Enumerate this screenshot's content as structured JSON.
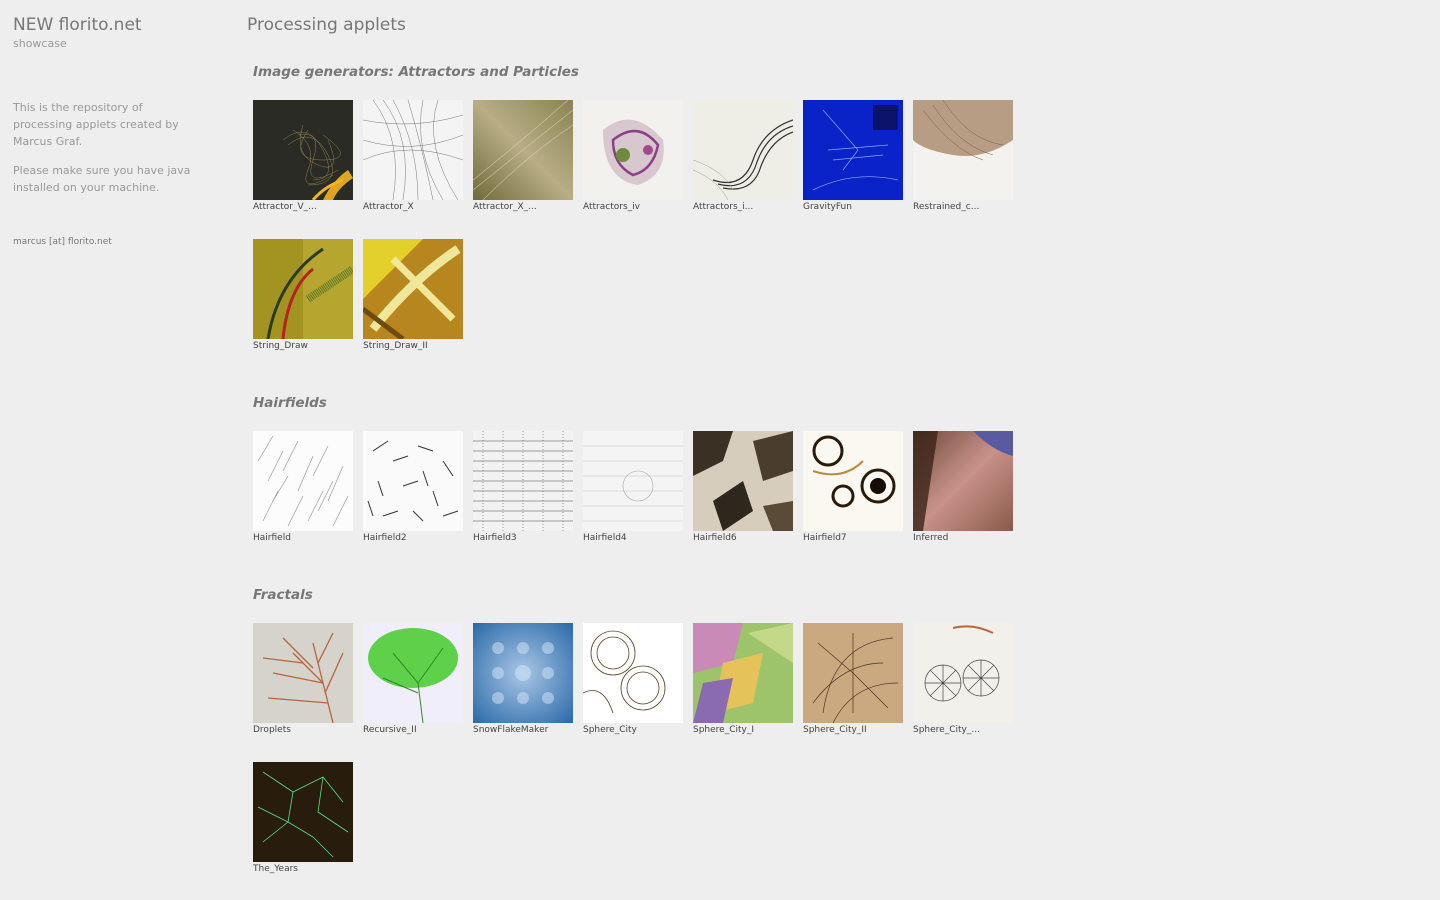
{
  "sidebar": {
    "title": "NEW florito.net",
    "subtitle": "showcase",
    "description": "This is the repository of processing applets created by Marcus Graf.",
    "java_note": "Please make sure you have java installed on your machine.",
    "contact": "marcus [at] florito.net"
  },
  "main": {
    "title": "Processing applets",
    "sections": [
      {
        "title": "Image generators: Attractors and Particles",
        "items": [
          {
            "label": "Attractor_V_..."
          },
          {
            "label": "Attractor_X"
          },
          {
            "label": "Attractor_X_..."
          },
          {
            "label": "Attractors_iv"
          },
          {
            "label": "Attractors_i..."
          },
          {
            "label": "GravityFun"
          },
          {
            "label": "Restrained_c..."
          },
          {
            "label": "String_Draw"
          },
          {
            "label": "String_Draw_II"
          }
        ]
      },
      {
        "title": "Hairfields",
        "items": [
          {
            "label": "Hairfield"
          },
          {
            "label": "Hairfield2"
          },
          {
            "label": "Hairfield3"
          },
          {
            "label": "Hairfield4"
          },
          {
            "label": "Hairfield6"
          },
          {
            "label": "Hairfield7"
          },
          {
            "label": "Inferred"
          }
        ]
      },
      {
        "title": "Fractals",
        "items": [
          {
            "label": "Droplets"
          },
          {
            "label": "Recursive_II"
          },
          {
            "label": "SnowFlakeMaker"
          },
          {
            "label": "Sphere_City"
          },
          {
            "label": "Sphere_City_I"
          },
          {
            "label": "Sphere_City_II"
          },
          {
            "label": "Sphere_City_..."
          },
          {
            "label": "The_Years"
          }
        ]
      }
    ]
  }
}
